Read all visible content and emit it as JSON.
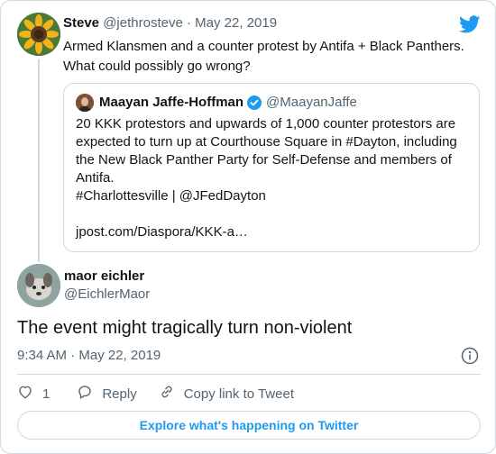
{
  "parent": {
    "name": "Steve",
    "handle": "@jethrosteve",
    "separator": "·",
    "date": "May 22, 2019",
    "text": "Armed Klansmen and a counter protest by Antifa + Black Panthers. What could possibly go wrong?",
    "avatar_icon": "sunflower-avatar"
  },
  "quote": {
    "name": "Maayan Jaffe-Hoffman",
    "handle": "@MaayanJaffe",
    "verified": true,
    "text_lines": [
      "20 KKK protestors and upwards of 1,000 counter protestors are",
      "expected to turn up at Courthouse Square in #Dayton, including",
      "the New Black Panther Party for Self-Defense and members of",
      "Antifa.",
      "#Charlottesville | @JFedDayton"
    ],
    "link": "jpost.com/Diaspora/KKK-a…"
  },
  "reply": {
    "name": "maor eichler",
    "handle": "@EichlerMaor",
    "text": "The event might tragically turn non-violent",
    "timestamp": "9:34 AM · May 22, 2019",
    "avatar_icon": "dog-avatar"
  },
  "actions": {
    "like_count": "1",
    "reply_label": "Reply",
    "copy_label": "Copy link to Tweet"
  },
  "footer": {
    "explore_label": "Explore what's happening on Twitter"
  },
  "colors": {
    "accent": "#1d9bf0",
    "text": "#0f1419",
    "muted": "#536471",
    "border": "#cfd9de"
  }
}
